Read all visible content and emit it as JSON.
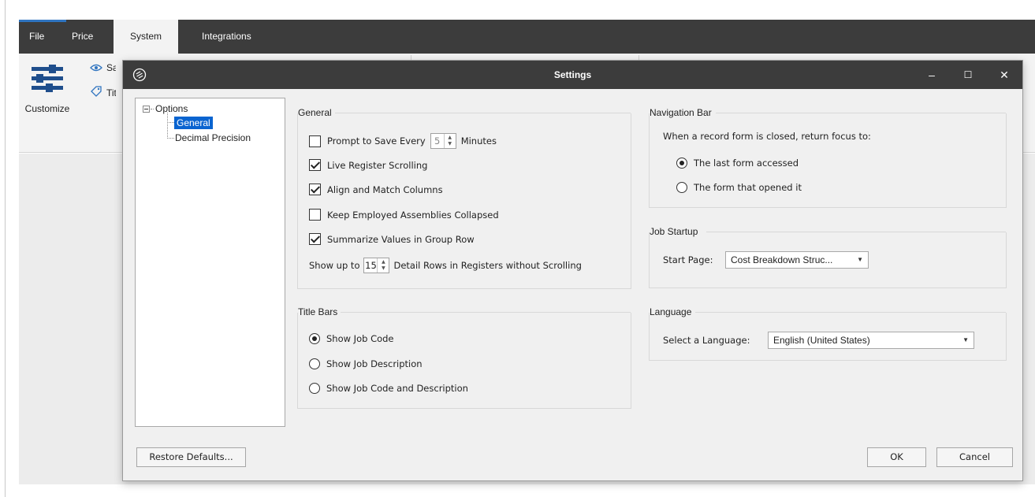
{
  "app": {
    "tabs": [
      {
        "label": "File"
      },
      {
        "label": "Price"
      },
      {
        "label": "System",
        "active": true
      },
      {
        "label": "Integrations"
      }
    ],
    "ribbon": {
      "customize_label": "Customize",
      "save_label_truncated": "Sa",
      "title_label_truncated": "Tit"
    }
  },
  "dialog": {
    "title": "Settings",
    "window_buttons": {
      "minimize": "–",
      "maximize": "☐",
      "close": "✕"
    },
    "tree": {
      "root": "Options",
      "children": [
        {
          "label": "General",
          "selected": true
        },
        {
          "label": "Decimal Precision"
        }
      ]
    },
    "general": {
      "title": "General",
      "prompt_save": {
        "label_before": "Prompt to Save Every",
        "value": "5",
        "label_after": "Minutes",
        "checked": false
      },
      "live_register_scrolling": {
        "label": "Live Register Scrolling",
        "checked": true
      },
      "align_match_columns": {
        "label": "Align and Match Columns",
        "checked": true
      },
      "keep_collapsed": {
        "label": "Keep Employed Assemblies Collapsed",
        "checked": false
      },
      "summarize_values": {
        "label": "Summarize Values in Group Row",
        "checked": true
      },
      "show_up_to": {
        "label_before": "Show up to",
        "value": "15",
        "label_after": "Detail Rows in Registers without Scrolling"
      }
    },
    "title_bars": {
      "title": "Title Bars",
      "options": [
        {
          "label": "Show Job Code",
          "selected": true
        },
        {
          "label": "Show Job Description",
          "selected": false
        },
        {
          "label": "Show Job Code and Description",
          "selected": false
        }
      ]
    },
    "navigation_bar": {
      "title": "Navigation Bar",
      "prompt": "When a record form is closed, return focus to:",
      "options": [
        {
          "label": "The last form accessed",
          "selected": true
        },
        {
          "label": "The form that opened it",
          "selected": false
        }
      ]
    },
    "job_startup": {
      "title": "Job Startup",
      "label": "Start Page:",
      "value": "Cost Breakdown Struc..."
    },
    "language": {
      "title": "Language",
      "label": "Select a Language:",
      "value": "English (United States)"
    },
    "buttons": {
      "restore": "Restore Defaults...",
      "ok": "OK",
      "cancel": "Cancel"
    }
  },
  "colors": {
    "titlebar": "#3c3c3c",
    "selection": "#0a64d0",
    "accent": "#2f74c0"
  }
}
